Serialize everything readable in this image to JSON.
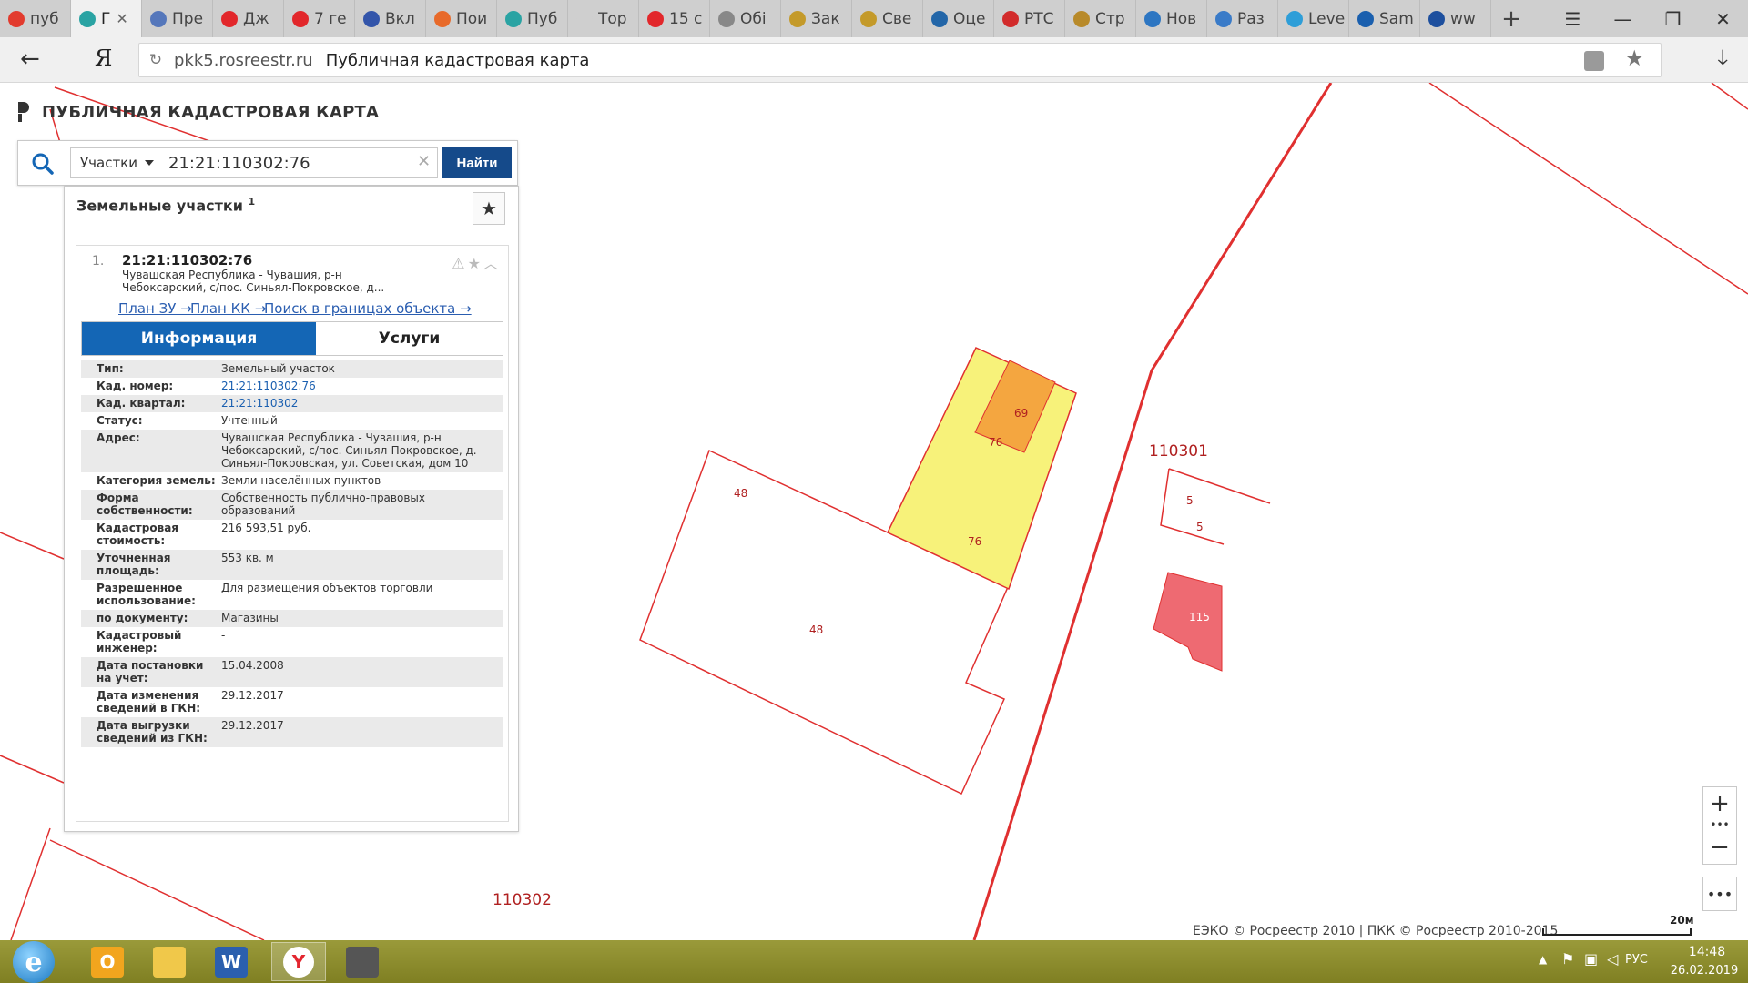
{
  "browser": {
    "tabs": [
      {
        "label": "пуб",
        "icon": "yandex-icon",
        "color": "#e23b2e"
      },
      {
        "label": "Г",
        "icon": "rosreestr-icon",
        "color": "#2aa3a3",
        "active": true
      },
      {
        "label": "Пре",
        "icon": "gosuslugi-icon",
        "color": "#5577bb"
      },
      {
        "label": "Дж",
        "icon": "zen-icon",
        "color": "#e2272b"
      },
      {
        "label": "7 ге",
        "icon": "zen-icon",
        "color": "#e2272b"
      },
      {
        "label": "Вкл",
        "icon": "flag-icon",
        "color": "#3355aa"
      },
      {
        "label": "Пои",
        "icon": "orange-icon",
        "color": "#e86a2a"
      },
      {
        "label": "Пуб",
        "icon": "rosreestr-icon",
        "color": "#2aa3a3"
      },
      {
        "label": "Тор",
        "icon": "blank-icon",
        "color": "#cfcfcf"
      },
      {
        "label": "15 с",
        "icon": "zen-icon",
        "color": "#e2272b"
      },
      {
        "label": "Обі",
        "icon": "doc-icon",
        "color": "#888888"
      },
      {
        "label": "Зак",
        "icon": "emblem-icon",
        "color": "#c49a2a"
      },
      {
        "label": "Све",
        "icon": "emblem-icon",
        "color": "#c49a2a"
      },
      {
        "label": "Оце",
        "icon": "diamond-icon",
        "color": "#2366a8"
      },
      {
        "label": "РТС",
        "icon": "rts-icon",
        "color": "#d22b2b"
      },
      {
        "label": "Стр",
        "icon": "wheat-icon",
        "color": "#b88a2a"
      },
      {
        "label": "Нов",
        "icon": "bird-icon",
        "color": "#2d76c2"
      },
      {
        "label": "Раз",
        "icon": "stripes-icon",
        "color": "#3a7bc8"
      },
      {
        "label": "Leve",
        "icon": "globe-icon",
        "color": "#2e9ed8"
      },
      {
        "label": "Sam",
        "icon": "c-icon",
        "color": "#1a5fae"
      },
      {
        "label": "ww",
        "icon": "site-icon",
        "color": "#1d4f9e"
      }
    ],
    "new_tab": "+",
    "url_domain": "pkk5.rosreestr.ru",
    "url_title": "Публичная кадастровая карта",
    "yandex_logo": "Я"
  },
  "app": {
    "title": "ПУБЛИЧНАЯ КАДАСТРОВАЯ КАРТА",
    "search": {
      "type_select": "Участки",
      "query": "21:21:110302:76",
      "find_label": "Найти"
    }
  },
  "results": {
    "header": "Земельные участки",
    "count": "1",
    "item": {
      "number": "1.",
      "cad_number": "21:21:110302:76",
      "address_short": "Чувашская Республика - Чувашия, р-н Чебоксарский, с/пос. Синьял-Покровское, д...",
      "links": [
        "План ЗУ →",
        "План КК →",
        "Поиск в границах объекта →"
      ],
      "tabs": {
        "info": "Информация",
        "services": "Услуги"
      },
      "info": [
        {
          "key": "Тип:",
          "value": "Земельный участок"
        },
        {
          "key": "Кад. номер:",
          "value": "21:21:110302:76",
          "link": true
        },
        {
          "key": "Кад. квартал:",
          "value": "21:21:110302",
          "link": true
        },
        {
          "key": "Статус:",
          "value": "Учтенный"
        },
        {
          "key": "Адрес:",
          "value": "Чувашская Республика - Чувашия, р-н Чебоксарский, с/пос. Синьял-Покровское, д. Синьял-Покровская, ул. Советская, дом 10"
        },
        {
          "key": "Категория земель:",
          "value": "Земли населённых пунктов"
        },
        {
          "key": "Форма собственности:",
          "value": "Собственность публично-правовых образований"
        },
        {
          "key": "Кадастровая стоимость:",
          "value": "216 593,51 руб."
        },
        {
          "key": "Уточненная площадь:",
          "value": "553 кв. м"
        },
        {
          "key": "Разрешенное использование:",
          "value": "Для размещения объектов торговли"
        },
        {
          "key": "по документу:",
          "value": "Магазины"
        },
        {
          "key": "Кадастровый инженер:",
          "value": "-"
        },
        {
          "key": "Дата постановки на учет:",
          "value": "15.04.2008"
        },
        {
          "key": "Дата изменения сведений в ГКН:",
          "value": "29.12.2017"
        },
        {
          "key": "Дата выгрузки сведений из ГКН:",
          "value": "29.12.2017"
        }
      ]
    }
  },
  "map": {
    "plot_labels": [
      "48",
      "48",
      "76",
      "76",
      "69",
      "5",
      "5",
      "115"
    ],
    "quarter_labels": [
      "110301",
      "110302"
    ],
    "copyright": "ЕЭКО © Росреестр 2010 | ПКК © Росреестр 2010-2015",
    "scale": "20м",
    "colors": {
      "boundary": "#e03030",
      "selected": "#f7f27a",
      "building": "#f4a640",
      "highlight": "#ee6a72"
    }
  },
  "taskbar": {
    "apps": [
      "ie-icon",
      "outlook-icon",
      "explorer-icon",
      "word-icon",
      "yandex-browser-icon",
      "scanner-icon"
    ],
    "language": "РУС",
    "time": "14:48",
    "date": "26.02.2019"
  }
}
